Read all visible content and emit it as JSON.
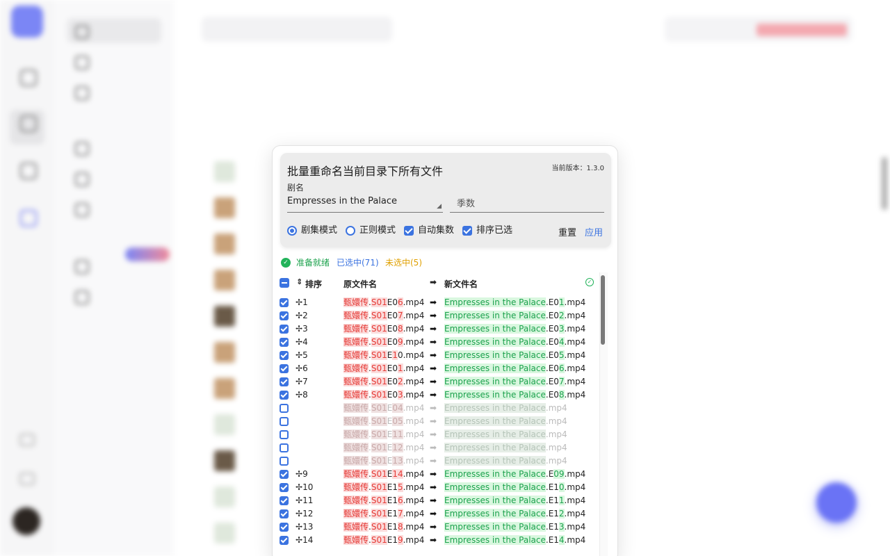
{
  "modal": {
    "title": "批量重命名当前目录下所有文件",
    "version": "当前版本：1.3.0",
    "drama_label": "剧名",
    "drama_value": "Empresses in the Palace",
    "season_placeholder": "季数",
    "options": {
      "episode_mode": "剧集模式",
      "regex_mode": "正则模式",
      "auto_episode": "自动集数",
      "sort_selected": "排序已选"
    },
    "reset": "重置",
    "apply": "应用",
    "status": {
      "ready": "准备就绪",
      "selected": "已选中(71)",
      "unselected": "未选中(5)"
    },
    "headers": {
      "sort": "排序",
      "original": "原文件名",
      "new": "新文件名"
    },
    "rows": [
      {
        "checked": true,
        "idx": "1",
        "o1": "甄嬛传",
        "o2": ".",
        "o3": "S01",
        "o4": "E0",
        "o5": "6",
        "o6": ".mp4",
        "n1": "Empresses in the Palace",
        "n2": ".E0",
        "n3": "1",
        "n4": ".mp4"
      },
      {
        "checked": true,
        "idx": "2",
        "o1": "甄嬛传",
        "o2": ".",
        "o3": "S01",
        "o4": "E0",
        "o5": "7",
        "o6": ".mp4",
        "n1": "Empresses in the Palace",
        "n2": ".E0",
        "n3": "2",
        "n4": ".mp4"
      },
      {
        "checked": true,
        "idx": "3",
        "o1": "甄嬛传",
        "o2": ".",
        "o3": "S01",
        "o4": "E0",
        "o5": "8",
        "o6": ".mp4",
        "n1": "Empresses in the Palace",
        "n2": ".E0",
        "n3": "3",
        "n4": ".mp4"
      },
      {
        "checked": true,
        "idx": "4",
        "o1": "甄嬛传",
        "o2": ".",
        "o3": "S01",
        "o4": "E0",
        "o5": "9",
        "o6": ".mp4",
        "n1": "Empresses in the Palace",
        "n2": ".E0",
        "n3": "4",
        "n4": ".mp4"
      },
      {
        "checked": true,
        "idx": "5",
        "o1": "甄嬛传",
        "o2": ".",
        "o3": "S01",
        "o4": "E",
        "o5": "1",
        "o6": "0.mp4",
        "n1": "Empresses in the Palace",
        "n2": ".E0",
        "n3": "5",
        "n4": ".mp4"
      },
      {
        "checked": true,
        "idx": "6",
        "o1": "甄嬛传",
        "o2": ".",
        "o3": "S01",
        "o4": "E0",
        "o5": "1",
        "o6": ".mp4",
        "n1": "Empresses in the Palace",
        "n2": ".E0",
        "n3": "6",
        "n4": ".mp4"
      },
      {
        "checked": true,
        "idx": "7",
        "o1": "甄嬛传",
        "o2": ".",
        "o3": "S01",
        "o4": "E0",
        "o5": "2",
        "o6": ".mp4",
        "n1": "Empresses in the Palace",
        "n2": ".E0",
        "n3": "7",
        "n4": ".mp4"
      },
      {
        "checked": true,
        "idx": "8",
        "o1": "甄嬛传",
        "o2": ".",
        "o3": "S01",
        "o4": "E0",
        "o5": "3",
        "o6": ".mp4",
        "n1": "Empresses in the Palace",
        "n2": ".E0",
        "n3": "8",
        "n4": ".mp4"
      },
      {
        "checked": false,
        "idx": "",
        "o1": "甄嬛传",
        "o2": ".",
        "o3": "S01",
        "o4": "E",
        "o5": "04",
        "o6": ".mp4",
        "n1": "Empresses in the Palace",
        "n2": "",
        "n3": "",
        "n4": ".mp4"
      },
      {
        "checked": false,
        "idx": "",
        "o1": "甄嬛传",
        "o2": ".",
        "o3": "S01",
        "o4": "E",
        "o5": "05",
        "o6": ".mp4",
        "n1": "Empresses in the Palace",
        "n2": "",
        "n3": "",
        "n4": ".mp4"
      },
      {
        "checked": false,
        "idx": "",
        "o1": "甄嬛传",
        "o2": ".",
        "o3": "S01",
        "o4": "E",
        "o5": "11",
        "o6": ".mp4",
        "n1": "Empresses in the Palace",
        "n2": "",
        "n3": "",
        "n4": ".mp4"
      },
      {
        "checked": false,
        "idx": "",
        "o1": "甄嬛传",
        "o2": ".",
        "o3": "S01",
        "o4": "E",
        "o5": "12",
        "o6": ".mp4",
        "n1": "Empresses in the Palace",
        "n2": "",
        "n3": "",
        "n4": ".mp4"
      },
      {
        "checked": false,
        "idx": "",
        "o1": "甄嬛传",
        "o2": ".",
        "o3": "S01",
        "o4": "E",
        "o5": "13",
        "o6": ".mp4",
        "n1": "Empresses in the Palace",
        "n2": "",
        "n3": "",
        "n4": ".mp4"
      },
      {
        "checked": true,
        "idx": "9",
        "o1": "甄嬛传",
        "o2": ".",
        "o3": "S01",
        "o4": "E",
        "o5": "14",
        "o6": ".mp4",
        "n1": "Empresses in the Palace",
        "n2": ".E",
        "n3": "09",
        "n4": ".mp4"
      },
      {
        "checked": true,
        "idx": "10",
        "o1": "甄嬛传",
        "o2": ".",
        "o3": "S01",
        "o4": "E1",
        "o5": "5",
        "o6": ".mp4",
        "n1": "Empresses in the Palace",
        "n2": ".E1",
        "n3": "0",
        "n4": ".mp4"
      },
      {
        "checked": true,
        "idx": "11",
        "o1": "甄嬛传",
        "o2": ".",
        "o3": "S01",
        "o4": "E1",
        "o5": "6",
        "o6": ".mp4",
        "n1": "Empresses in the Palace",
        "n2": ".E1",
        "n3": "1",
        "n4": ".mp4"
      },
      {
        "checked": true,
        "idx": "12",
        "o1": "甄嬛传",
        "o2": ".",
        "o3": "S01",
        "o4": "E1",
        "o5": "7",
        "o6": ".mp4",
        "n1": "Empresses in the Palace",
        "n2": ".E1",
        "n3": "2",
        "n4": ".mp4"
      },
      {
        "checked": true,
        "idx": "13",
        "o1": "甄嬛传",
        "o2": ".",
        "o3": "S01",
        "o4": "E1",
        "o5": "8",
        "o6": ".mp4",
        "n1": "Empresses in the Palace",
        "n2": ".E1",
        "n3": "3",
        "n4": ".mp4"
      },
      {
        "checked": true,
        "idx": "14",
        "o1": "甄嬛传",
        "o2": ".",
        "o3": "S01",
        "o4": "E1",
        "o5": "9",
        "o6": ".mp4",
        "n1": "Empresses in the Palace",
        "n2": ".E1",
        "n3": "4",
        "n4": ".mp4"
      }
    ]
  },
  "colors": {
    "accent": "#3b73e0",
    "ready": "#1ca24d",
    "unselected": "#e0a000",
    "highlight_red": "#e53935",
    "highlight_green": "#1ca24d"
  }
}
